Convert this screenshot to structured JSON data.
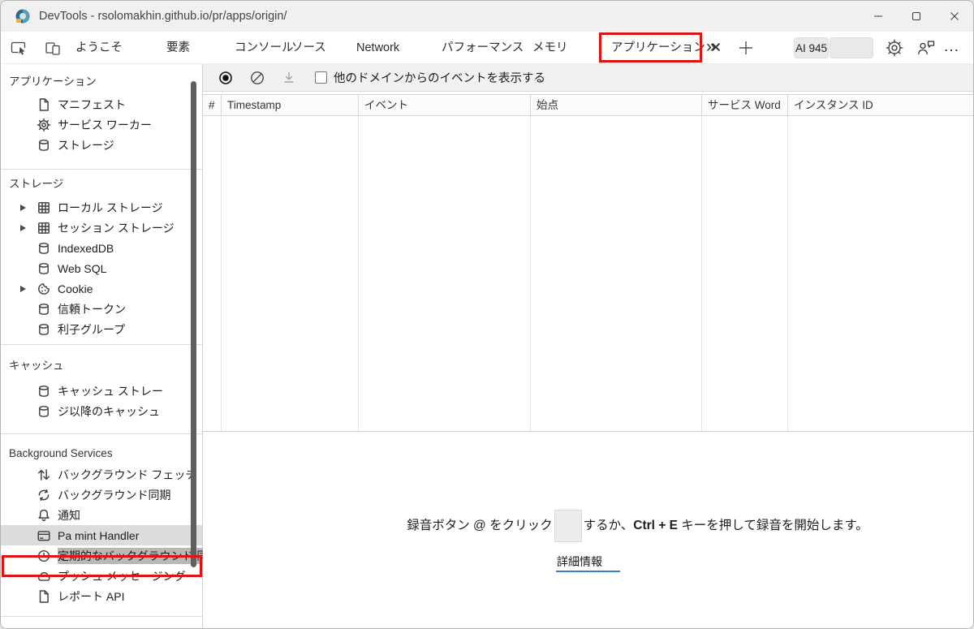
{
  "window": {
    "title": "DevTools - rsolomakhin.github.io/pr/apps/origin/"
  },
  "tabbar": {
    "tabs": [
      "ようこそ",
      "要素",
      "コンソール",
      "ソース",
      "Network",
      "パフォーマンス",
      "メモリ"
    ],
    "application_tab": "アプリケーション",
    "overflow_glyph": "»",
    "ai_chip_label": "AI 945",
    "more_glyph": "…"
  },
  "sidebar": {
    "sections": [
      {
        "title": "アプリケーション",
        "items": [
          {
            "icon": "document-icon",
            "label": "マニフェスト"
          },
          {
            "icon": "gear-icon",
            "label": "サービス ワーカー"
          },
          {
            "icon": "database-icon",
            "label": "ストレージ"
          }
        ]
      },
      {
        "title": "ストレージ",
        "items": [
          {
            "icon": "table-icon",
            "label": "ローカル ストレージ"
          },
          {
            "icon": "table-icon",
            "label": "セッション ストレージ"
          },
          {
            "icon": "database-icon",
            "label": "IndexedDB"
          },
          {
            "icon": "database-icon",
            "label": "Web SQL"
          },
          {
            "icon": "cookie-icon",
            "label": "Cookie"
          },
          {
            "icon": "database-icon",
            "label": "信頼トークン"
          },
          {
            "icon": "database-icon",
            "label": "利子グループ"
          }
        ]
      },
      {
        "title": "キャッシュ",
        "items": [
          {
            "icon": "database-icon",
            "label": "キャッシュ ストレー"
          },
          {
            "icon": "database-icon",
            "label": "ジ以降のキャッシュ"
          }
        ]
      },
      {
        "title": "Background Services",
        "items": [
          {
            "icon": "background-fetch-icon",
            "label": "バックグラウンド フェッチ"
          },
          {
            "icon": "sync-icon",
            "label": "バックグラウンド同期"
          },
          {
            "icon": "bell-icon",
            "label": "通知"
          },
          {
            "icon": "payment-card-icon",
            "label": "Pa mint Handler"
          },
          {
            "icon": "clock-icon",
            "label": "定期的なバックグラウンド 同期"
          },
          {
            "icon": "cloud-icon",
            "label": "プッシュ メッセージング"
          },
          {
            "icon": "document-icon",
            "label": "レポート API"
          }
        ]
      }
    ]
  },
  "toolbar": {
    "show_events_label": "他のドメインからのイベントを表示する"
  },
  "table": {
    "columns": [
      "#",
      "Timestamp",
      "イベント",
      "始点",
      "サービス Word",
      "インスタンス ID"
    ]
  },
  "empty_state": {
    "msg_part1": "録音ボタン @ をクリック",
    "msg_part2": "するか、",
    "msg_kbd": "Ctrl + E",
    "msg_part3": " キーを押して録音を開始します。",
    "learn_more": "詳細情報"
  },
  "colors": {
    "annotation_red": "#e01212",
    "link_underline_blue": "#2f7fd0",
    "selection_gray": "#b8b8b8"
  }
}
